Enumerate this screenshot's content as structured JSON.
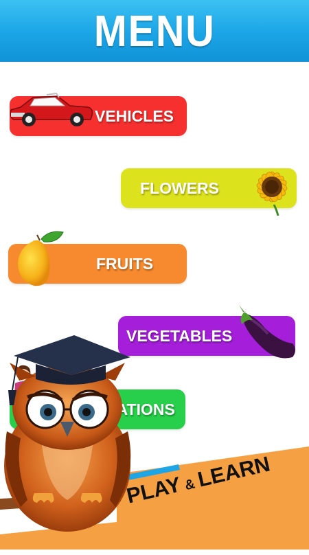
{
  "header": {
    "title": "MENU"
  },
  "menu": {
    "vehicles": {
      "label": "VEHICLES",
      "color": "#f5302f",
      "picture": "red-convertible-car"
    },
    "flowers": {
      "label": "FLOWERS",
      "color": "#dce21c",
      "picture": "sunflower"
    },
    "fruits": {
      "label": "FRUITS",
      "color": "#f78a2e",
      "picture": "mango"
    },
    "vegetables": {
      "label": "VEGETABLES",
      "color": "#a51fdb",
      "picture": "eggplant"
    },
    "occupations": {
      "label": "OCCUPATIONS",
      "visible_label": "PATIONS",
      "color": "#28cf4a",
      "picture": "teacher-figure"
    }
  },
  "banner": {
    "play": "PLAY",
    "amp": "&",
    "learn": "LEARN",
    "color": "#f5a043"
  },
  "mascot": {
    "picture": "owl-with-graduation-cap"
  }
}
